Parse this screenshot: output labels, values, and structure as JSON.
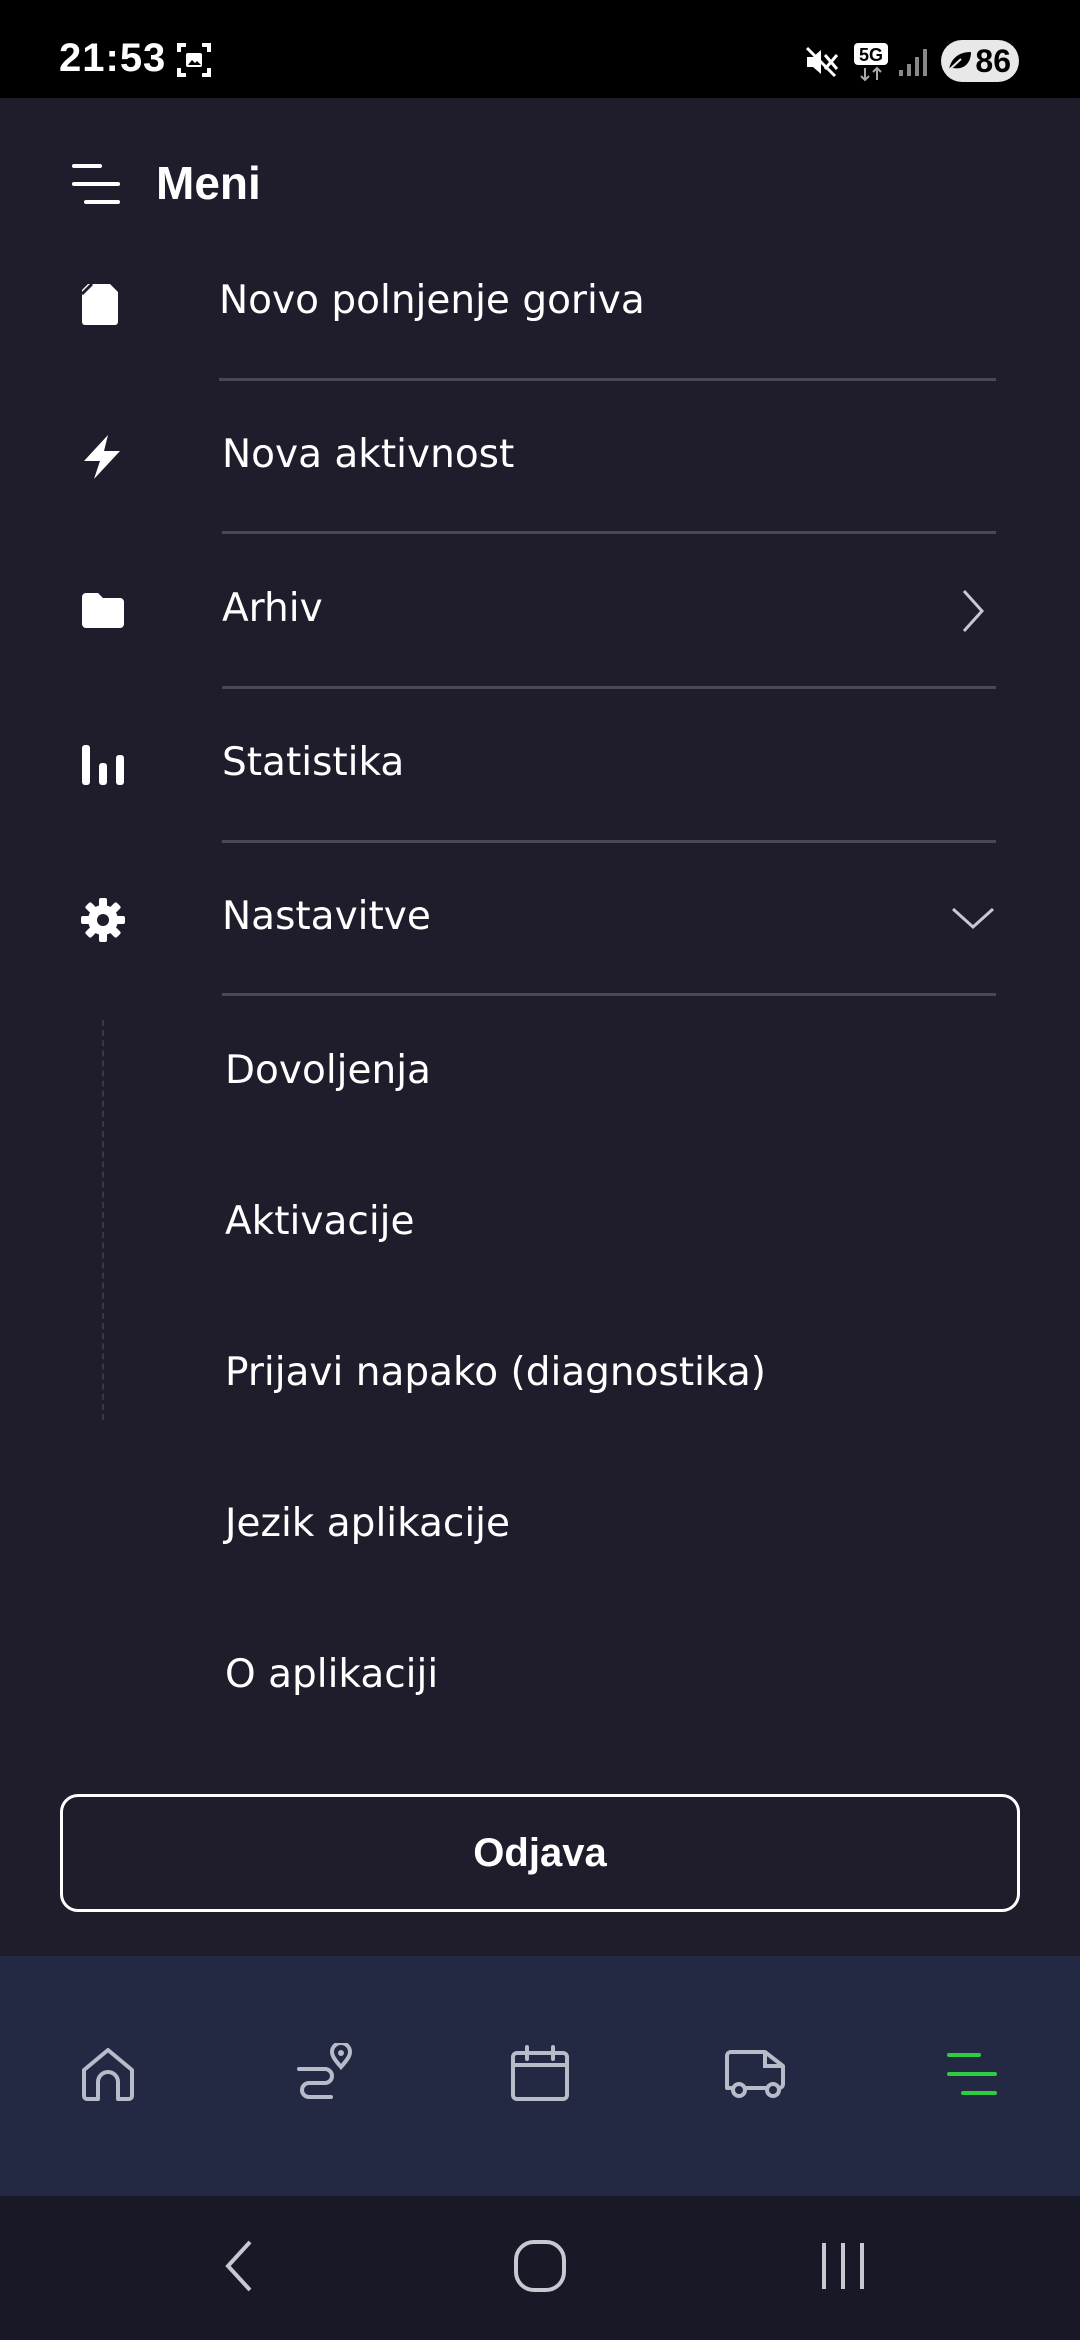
{
  "status_bar": {
    "time": "21:53",
    "network": "5G",
    "battery": "86",
    "icons": [
      "screenshot-icon",
      "mute-icon",
      "5g-icon",
      "signal-icon",
      "leaf-icon"
    ]
  },
  "menu": {
    "title": "Meni",
    "items": [
      {
        "label": "Novo polnjenje goriva",
        "icon": "fuel-icon"
      },
      {
        "label": "Nova aktivnost",
        "icon": "bolt-icon"
      },
      {
        "label": "Arhiv",
        "icon": "folder-icon",
        "trailing": "chevron-right-icon"
      },
      {
        "label": "Statistika",
        "icon": "bar-chart-icon"
      },
      {
        "label": "Nastavitve",
        "icon": "gear-icon",
        "trailing": "chevron-down-icon",
        "expanded": true
      }
    ],
    "settings_subitems": [
      {
        "label": "Dovoljenja"
      },
      {
        "label": "Aktivacije"
      },
      {
        "label": "Prijavi napako (diagnostika)"
      },
      {
        "label": "Jezik aplikacije"
      },
      {
        "label": "O aplikaciji"
      }
    ],
    "logout_label": "Odjava"
  },
  "bottom_nav": {
    "items": [
      {
        "icon": "home-icon",
        "active": false
      },
      {
        "icon": "route-icon",
        "active": false
      },
      {
        "icon": "calendar-icon",
        "active": false
      },
      {
        "icon": "truck-icon",
        "active": false
      },
      {
        "icon": "menu-icon",
        "active": true
      }
    ],
    "active_color": "#2ecc40",
    "inactive_color": "#b8bcc8"
  },
  "system_nav": {
    "items": [
      "back-icon",
      "home-circle-icon",
      "recents-icon"
    ]
  },
  "colors": {
    "background": "#1f1d2b",
    "bottom_nav_bg": "#232843",
    "divider": "#4a4858"
  }
}
